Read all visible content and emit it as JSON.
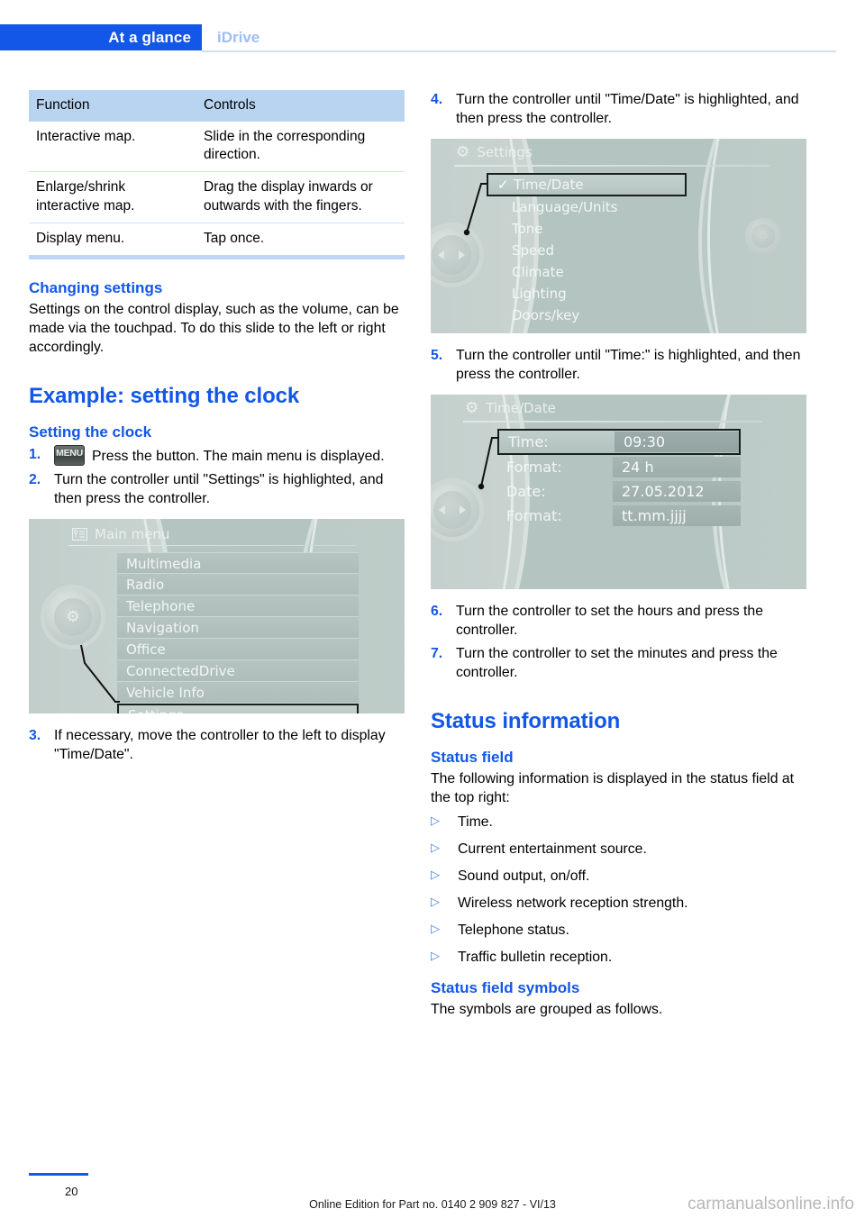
{
  "header": {
    "active_tab": "At a glance",
    "inactive_tab": "iDrive"
  },
  "left_column": {
    "table": {
      "headers": [
        "Function",
        "Controls"
      ],
      "rows": [
        [
          "Interactive map.",
          "Slide in the corresponding direction."
        ],
        [
          "Enlarge/shrink interactive map.",
          "Drag the display inwards or outwards with the fingers."
        ],
        [
          "Display menu.",
          "Tap once."
        ]
      ]
    },
    "changing_settings": {
      "heading": "Changing settings",
      "paragraph": "Settings on the control display, such as the volume, can be made via the touchpad. To do this slide to the left or right accordingly."
    },
    "example_heading": "Example: setting the clock",
    "setting_clock_heading": "Setting the clock",
    "steps": [
      {
        "num": "1.",
        "icon": "MENU",
        "text": "Press the button. The main menu is displayed."
      },
      {
        "num": "2.",
        "text": "Turn the controller until \"Settings\" is highlighted, and then press the controller."
      }
    ],
    "step3": {
      "num": "3.",
      "text": "If necessary, move the controller to the left to display \"Time/Date\"."
    },
    "main_menu_screen": {
      "title": "Main menu",
      "items": [
        {
          "label": "Multimedia",
          "selected": false
        },
        {
          "label": "Radio",
          "selected": false
        },
        {
          "label": "Telephone",
          "selected": false
        },
        {
          "label": "Navigation",
          "selected": false
        },
        {
          "label": "Office",
          "selected": false
        },
        {
          "label": "ConnectedDrive",
          "selected": false
        },
        {
          "label": "Vehicle Info",
          "selected": false
        },
        {
          "label": "Settings",
          "selected": true
        }
      ]
    }
  },
  "right_column": {
    "step4": {
      "num": "4.",
      "text": "Turn the controller until \"Time/Date\" is highlighted, and then press the controller."
    },
    "settings_screen": {
      "title": "Settings",
      "items": [
        {
          "label": "Time/Date",
          "selected": true,
          "check": "✓"
        },
        {
          "label": "Language/Units",
          "selected": false
        },
        {
          "label": "Tone",
          "selected": false
        },
        {
          "label": "Speed",
          "selected": false
        },
        {
          "label": "Climate",
          "selected": false
        },
        {
          "label": "Lighting",
          "selected": false
        },
        {
          "label": "Doors/key",
          "selected": false
        }
      ]
    },
    "step5": {
      "num": "5.",
      "text": "Turn the controller until \"Time:\" is highlighted, and then press the controller."
    },
    "timedate_screen": {
      "title": "Time/Date",
      "fields": [
        {
          "label": "Time:",
          "value": "09:30",
          "selected": true
        },
        {
          "label": "Format:",
          "value": "24 h",
          "selected": false
        },
        {
          "label": "Date:",
          "value": "27.05.2012",
          "selected": false
        },
        {
          "label": "Format:",
          "value": "tt.mm.jjjj",
          "selected": false
        }
      ]
    },
    "step6": {
      "num": "6.",
      "text": "Turn the controller to set the hours and press the controller."
    },
    "step7": {
      "num": "7.",
      "text": "Turn the controller to set the minutes and press the controller."
    },
    "status_information_heading": "Status information",
    "status_field_heading": "Status field",
    "status_field_intro": "The following information is displayed in the status field at the top right:",
    "status_field_bullets": [
      "Time.",
      "Current entertainment source.",
      "Sound output, on/off.",
      "Wireless network reception strength.",
      "Telephone status.",
      "Traffic bulletin reception."
    ],
    "status_symbols_heading": "Status field symbols",
    "status_symbols_text": "The symbols are grouped as follows."
  },
  "footer": {
    "page_number": "20",
    "edition_note": "Online Edition for Part no. 0140 2 909 827 - VI/13",
    "watermark": "carmanualsonline.info"
  },
  "colors": {
    "brand_blue": "#1257e8",
    "tab_inactive": "#9dbdf5",
    "table_header_bg": "#b9d4f1",
    "table_rule": "#cfe0fb",
    "screen_bg": "#b4c4c1"
  }
}
